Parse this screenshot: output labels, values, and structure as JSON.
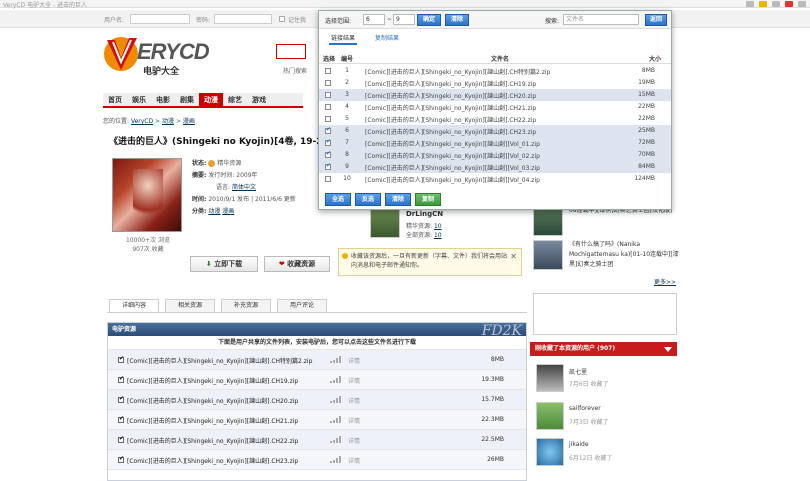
{
  "window": {
    "title": "VeryCD 电驴大全 - 进击的巨人"
  },
  "topbar": {
    "username_label": "用户名:",
    "password_label": "密码:",
    "remember_label": "记住我"
  },
  "logo": {
    "name": "ERYCD",
    "sub": "电驴大全"
  },
  "hot_search": "热门搜索",
  "nav": [
    "首页",
    "娱乐",
    "电影",
    "剧集",
    "动漫",
    "综艺",
    "游戏"
  ],
  "nav_active": 4,
  "breadcrumb": {
    "prefix": "您的位置:",
    "items": [
      "VeryCD",
      "动漫",
      "漫画"
    ],
    "sep": ">"
  },
  "page_title": "《进击的巨人》(Shingeki no Kyojin)[4卷, 19-2",
  "cover_stats": {
    "views": "10000+次 浏览",
    "favs": "907次 收藏"
  },
  "info": {
    "status_label": "状态:",
    "status_value": "精华资源",
    "summary_label": "摘要:",
    "summary_value": "发行时间: 2009年",
    "lang_label": "语言:",
    "lang_value": "简体中文",
    "time_label": "时间:",
    "time_value": "2010/9/1 发布 | 2011/6/6 更新",
    "cat_label": "分类:",
    "cat_1": "动漫",
    "cat_2": "漫画"
  },
  "buttons": {
    "download": "立即下载",
    "favorite": "收藏资源"
  },
  "uploader": {
    "name": "DrLingCN",
    "r1_label": "精华资源:",
    "r1_value": "10",
    "r2_label": "全部资源:",
    "r2_value": "10"
  },
  "tip": {
    "text": "收藏该资源后，一旦有新更新（字幕、文件）我们将会用站内消息和电子邮件通知你。"
  },
  "subtabs": [
    "详细内容",
    "相关资源",
    "补充资源",
    "用户评论"
  ],
  "resource": {
    "header": "电驴资源",
    "watermark": "FD2K",
    "desc": "下面是用户共享的文件列表，安装电驴后，您可以点击这些文件名进行下载",
    "detail_label": "详情",
    "files": [
      {
        "name": "[Comic][进击的巨人][Shingeki_no_Kyojin][諫山創].CH特别篇2.zip",
        "size": "8MB"
      },
      {
        "name": "[Comic][进击的巨人][Shingeki_no_Kyojin][諫山創].CH19.zip",
        "size": "19.3MB"
      },
      {
        "name": "[Comic][进击的巨人][Shingeki_no_Kyojin][諫山創].CH20.zip",
        "size": "15.7MB"
      },
      {
        "name": "[Comic][进击的巨人][Shingeki_no_Kyojin][諫山創].CH21.zip",
        "size": "22.3MB"
      },
      {
        "name": "[Comic][进击的巨人][Shingeki_no_Kyojin][諫山創].CH22.zip",
        "size": "22.5MB"
      },
      {
        "name": "[Comic][进击的巨人][Shingeki_no_Kyojin][諫山創].CH23.zip",
        "size": "26MB"
      }
    ]
  },
  "sidebar": {
    "item1": "08连载中][漆黑]幻奏之骑士团[汉化版]",
    "item2": "《有什么搞了吗》(Nanika Mochigattemasu ka)[01-10连载中][漆黑]幻奏之骑士团",
    "more": "更多>>",
    "users_header": "刚收藏了本资源的用户 (907)",
    "users": [
      {
        "name": "凯七里",
        "date": "7月6日 收藏了"
      },
      {
        "name": "sailforever",
        "date": "7月3日 收藏了"
      },
      {
        "name": "jikaide",
        "date": "6月12日 收藏了"
      }
    ]
  },
  "popup": {
    "range_label": "选择范围:",
    "range_from": "6",
    "range_sep": "~",
    "range_to": "9",
    "confirm": "确定",
    "clear": "清除",
    "search_label": "搜索:",
    "search_placeholder": "文件名",
    "back": "返回",
    "tab_links": "链接结果",
    "tab_copy": "复制结果",
    "col_select": "选择",
    "col_no": "编号",
    "col_name": "文件名",
    "col_size": "大小",
    "rows": [
      {
        "no": "1",
        "name": "[Comic][进击的巨人][Shingeki_no_Kyojin][諫山創].CH特别篇2.zip",
        "size": "8MB",
        "checked": false,
        "sel": false
      },
      {
        "no": "2",
        "name": "[Comic][进击的巨人][Shingeki_no_Kyojin][諫山創].CH19.zip",
        "size": "19MB",
        "checked": false,
        "sel": false
      },
      {
        "no": "3",
        "name": "[Comic][进击的巨人][Shingeki_no_Kyojin][諫山創].CH20.zip",
        "size": "15MB",
        "checked": false,
        "sel": true
      },
      {
        "no": "4",
        "name": "[Comic][进击的巨人][Shingeki_no_Kyojin][諫山創].CH21.zip",
        "size": "22MB",
        "checked": false,
        "sel": false
      },
      {
        "no": "5",
        "name": "[Comic][进击的巨人][Shingeki_no_Kyojin][諫山創].CH22.zip",
        "size": "22MB",
        "checked": false,
        "sel": false
      },
      {
        "no": "6",
        "name": "[Comic][进击的巨人][Shingeki_no_Kyojin][諫山創].CH23.zip",
        "size": "25MB",
        "checked": true,
        "sel": true
      },
      {
        "no": "7",
        "name": "[Comic][进击的巨人][Shingeki_no_Kyojin][諫山創][Vol_01.zip",
        "size": "72MB",
        "checked": true,
        "sel": true
      },
      {
        "no": "8",
        "name": "[Comic][进击的巨人][Shingeki_no_Kyojin][諫山創][Vol_02.zip",
        "size": "70MB",
        "checked": true,
        "sel": true
      },
      {
        "no": "9",
        "name": "[Comic][进击的巨人][Shingeki_no_Kyojin][諫山創][Vol_03.zip",
        "size": "84MB",
        "checked": true,
        "sel": true
      },
      {
        "no": "10",
        "name": "[Comic][进击的巨人][Shingeki_no_Kyojin][諫山創][Vol_04.zip",
        "size": "124MB",
        "checked": false,
        "sel": false
      }
    ],
    "select_all": "全选",
    "invert": "反选",
    "clear_sel": "清除",
    "copy": "复制"
  }
}
